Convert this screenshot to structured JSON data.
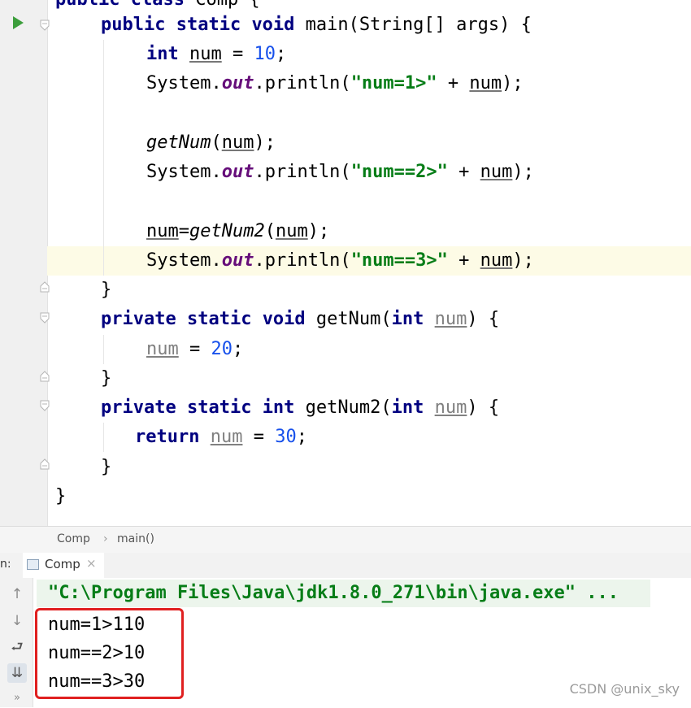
{
  "editor": {
    "lines": [
      {
        "tokens": [
          [
            "kw",
            "public "
          ],
          [
            "kw",
            "class "
          ],
          [
            "p",
            "Comp {"
          ]
        ]
      },
      {
        "tokens": [
          [
            "kw",
            "public "
          ],
          [
            "kw",
            "static "
          ],
          [
            "kw",
            "void "
          ],
          [
            "p",
            "main(String[] args) {"
          ]
        ]
      },
      {
        "tokens": [
          [
            "kw",
            "int "
          ],
          [
            "ul",
            "num"
          ],
          [
            "p",
            " = "
          ],
          [
            "num",
            "10"
          ],
          [
            "p",
            ";"
          ]
        ]
      },
      {
        "tokens": [
          [
            "p",
            "System."
          ],
          [
            "fld",
            "out"
          ],
          [
            "p",
            ".println("
          ],
          [
            "str",
            "\"num=1>\""
          ],
          [
            "p",
            " + "
          ],
          [
            "ul",
            "num"
          ],
          [
            "p",
            ");"
          ]
        ]
      },
      {
        "tokens": []
      },
      {
        "tokens": [
          [
            "it",
            "getNum"
          ],
          [
            "p",
            "("
          ],
          [
            "ul",
            "num"
          ],
          [
            "p",
            ");"
          ]
        ]
      },
      {
        "tokens": [
          [
            "p",
            "System."
          ],
          [
            "fld",
            "out"
          ],
          [
            "p",
            ".println("
          ],
          [
            "str",
            "\"num==2>\""
          ],
          [
            "p",
            " + "
          ],
          [
            "ul",
            "num"
          ],
          [
            "p",
            ");"
          ]
        ]
      },
      {
        "tokens": []
      },
      {
        "tokens": [
          [
            "ul",
            "num"
          ],
          [
            "p",
            "="
          ],
          [
            "it",
            "getNum2"
          ],
          [
            "p",
            "("
          ],
          [
            "ul",
            "num"
          ],
          [
            "p",
            ");"
          ]
        ]
      },
      {
        "tokens": [
          [
            "p",
            "System."
          ],
          [
            "fld",
            "out"
          ],
          [
            "p",
            ".println("
          ],
          [
            "str",
            "\"num==3>\""
          ],
          [
            "p",
            " + "
          ],
          [
            "ul",
            "num"
          ],
          [
            "p",
            ");"
          ]
        ]
      },
      {
        "tokens": [
          [
            "p",
            "}"
          ]
        ]
      },
      {
        "tokens": [
          [
            "kw",
            "private "
          ],
          [
            "kw",
            "static "
          ],
          [
            "kw",
            "void "
          ],
          [
            "p",
            "getNum("
          ],
          [
            "kw",
            "int "
          ],
          [
            "unused",
            "num"
          ],
          [
            "p",
            ") {"
          ]
        ]
      },
      {
        "tokens": [
          [
            "unused",
            "num"
          ],
          [
            "p",
            " = "
          ],
          [
            "num",
            "20"
          ],
          [
            "p",
            ";"
          ]
        ]
      },
      {
        "tokens": [
          [
            "p",
            "}"
          ]
        ]
      },
      {
        "tokens": [
          [
            "kw",
            "private "
          ],
          [
            "kw",
            "static "
          ],
          [
            "kw",
            "int "
          ],
          [
            "p",
            "getNum2("
          ],
          [
            "kw",
            "int "
          ],
          [
            "unused",
            "num"
          ],
          [
            "p",
            ") {"
          ]
        ]
      },
      {
        "tokens": [
          [
            "kw",
            "return "
          ],
          [
            "unused",
            "num"
          ],
          [
            "p",
            " = "
          ],
          [
            "num",
            "30"
          ],
          [
            "p",
            ";"
          ]
        ]
      },
      {
        "tokens": [
          [
            "p",
            "}"
          ]
        ]
      },
      {
        "tokens": [
          [
            "p",
            "}"
          ]
        ]
      }
    ]
  },
  "breadcrumb": {
    "class_name": "Comp",
    "separator": "›",
    "method_name": "main()"
  },
  "run_panel": {
    "side_label": "n:",
    "tab_label": "Comp",
    "tab_close": "×",
    "command_line": "\"C:\\Program Files\\Java\\jdk1.8.0_271\\bin\\java.exe\" ...",
    "output": [
      "num=1>110",
      "num==2>10",
      "num==3>30"
    ],
    "toolbar": {
      "up": "↑",
      "down": "↓",
      "wrap": "⮐",
      "scroll_end": "⇊",
      "more": "»"
    }
  },
  "watermark": "CSDN @unix_sky",
  "colors": {
    "keyword": "#000080",
    "number": "#1750eb",
    "string": "#067d17",
    "field": "#660e7a",
    "highlight_box": "#e02020"
  }
}
